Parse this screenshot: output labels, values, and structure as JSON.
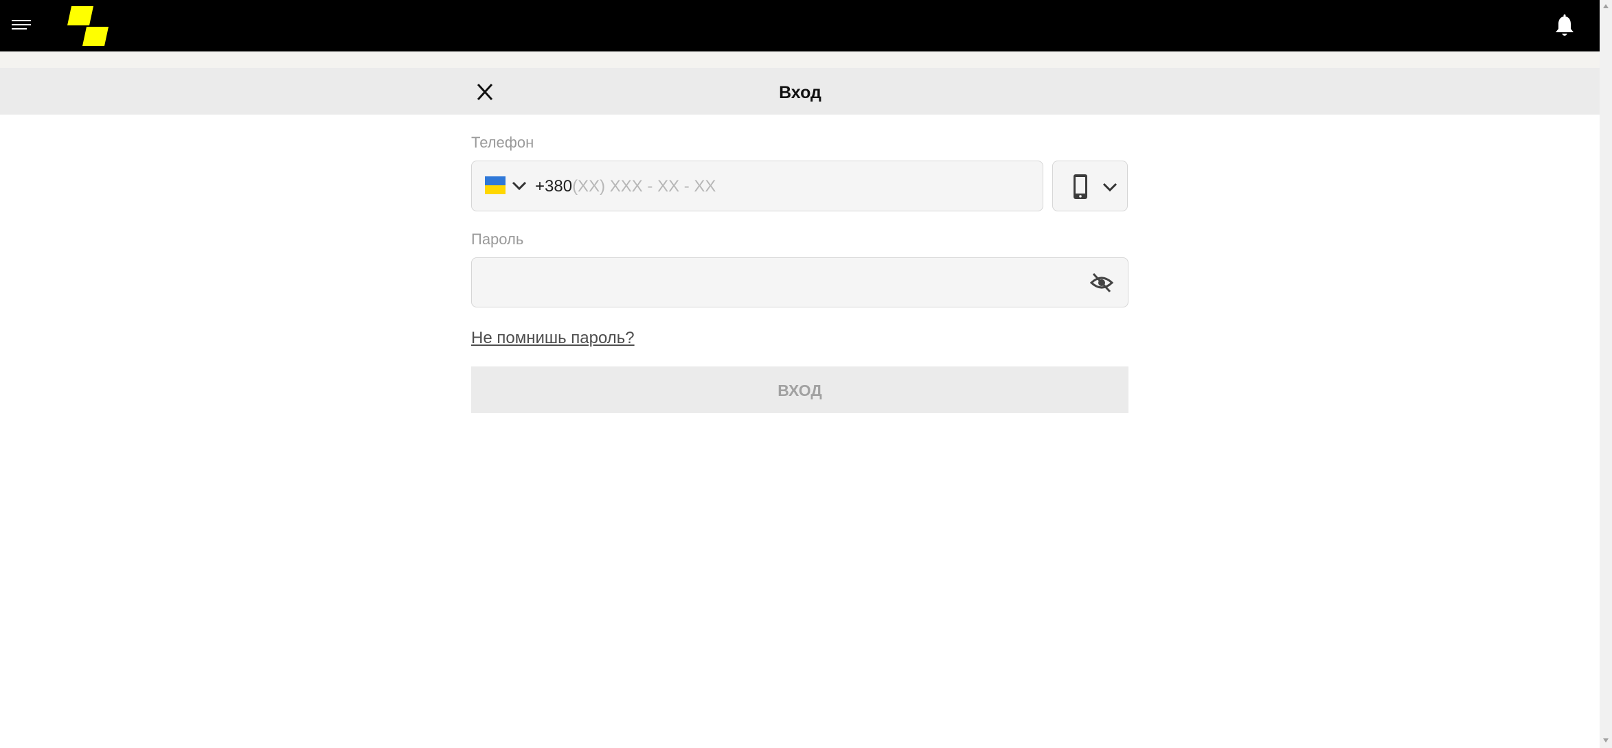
{
  "modal": {
    "title": "Вход"
  },
  "phone": {
    "label": "Телефон",
    "prefix": "+380",
    "mask": "(XX) XXX - XX - XX"
  },
  "password": {
    "label": "Пароль",
    "value": ""
  },
  "forgot_password": "Не помнишь пароль?",
  "submit_label": "ВХОД",
  "icons": {
    "menu": "hamburger-menu-icon",
    "logo": "brand-logo",
    "notifications": "bell-icon",
    "close": "close-icon",
    "country_flag": "ukraine-flag-icon",
    "chevron": "chevron-down-icon",
    "device": "smartphone-icon",
    "visibility": "eye-off-icon"
  },
  "colors": {
    "topbar": "#000000",
    "logo_yellow": "#ffff00",
    "header_bg": "#ebebeb",
    "field_bg": "#f5f5f5",
    "flag_blue": "#2f78d8",
    "flag_yellow": "#ffd700"
  }
}
